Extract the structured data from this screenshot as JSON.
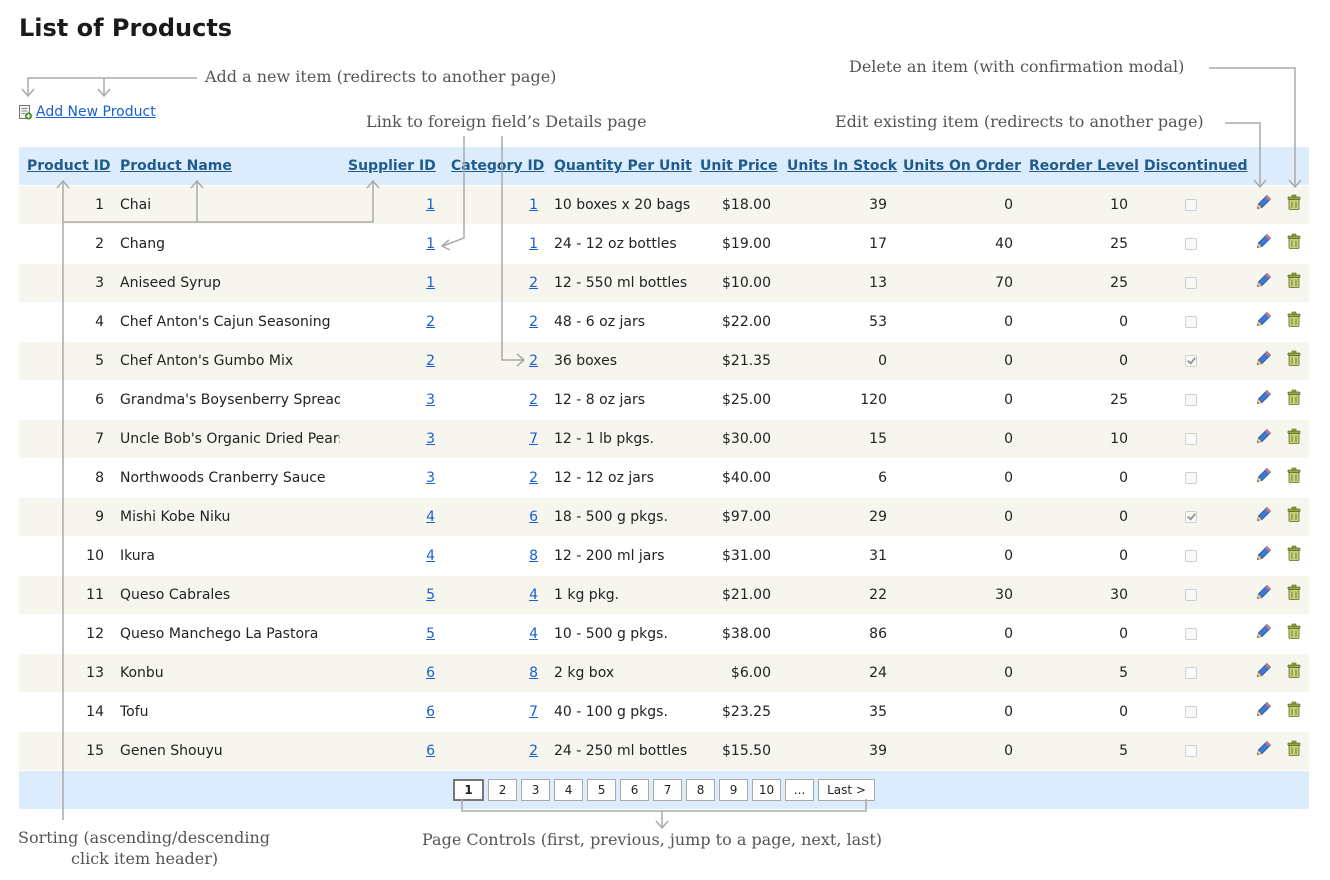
{
  "page": {
    "title": "List of Products"
  },
  "toolbar": {
    "add_label": "Add New Product",
    "add_icon": "add-item-icon"
  },
  "columns": [
    "Product ID",
    "Product Name",
    "Supplier ID",
    "Category ID",
    "Quantity Per Unit",
    "Unit Price",
    "Units In Stock",
    "Units On Order",
    "Reorder Level",
    "Discontinued"
  ],
  "rows": [
    {
      "id": "1",
      "name": "Chai",
      "supplier": "1",
      "category": "1",
      "qty": "10 boxes x 20 bags",
      "price": "$18.00",
      "stock": "39",
      "order": "0",
      "reorder": "10",
      "discontinued": false
    },
    {
      "id": "2",
      "name": "Chang",
      "supplier": "1",
      "category": "1",
      "qty": "24 - 12 oz bottles",
      "price": "$19.00",
      "stock": "17",
      "order": "40",
      "reorder": "25",
      "discontinued": false
    },
    {
      "id": "3",
      "name": "Aniseed Syrup",
      "supplier": "1",
      "category": "2",
      "qty": "12 - 550 ml bottles",
      "price": "$10.00",
      "stock": "13",
      "order": "70",
      "reorder": "25",
      "discontinued": false
    },
    {
      "id": "4",
      "name": "Chef Anton's Cajun Seasoning",
      "supplier": "2",
      "category": "2",
      "qty": "48 - 6 oz jars",
      "price": "$22.00",
      "stock": "53",
      "order": "0",
      "reorder": "0",
      "discontinued": false
    },
    {
      "id": "5",
      "name": "Chef Anton's Gumbo Mix",
      "supplier": "2",
      "category": "2",
      "qty": "36 boxes",
      "price": "$21.35",
      "stock": "0",
      "order": "0",
      "reorder": "0",
      "discontinued": true
    },
    {
      "id": "6",
      "name": "Grandma's Boysenberry Spread",
      "supplier": "3",
      "category": "2",
      "qty": "12 - 8 oz jars",
      "price": "$25.00",
      "stock": "120",
      "order": "0",
      "reorder": "25",
      "discontinued": false
    },
    {
      "id": "7",
      "name": "Uncle Bob's Organic Dried Pears",
      "supplier": "3",
      "category": "7",
      "qty": "12 - 1 lb pkgs.",
      "price": "$30.00",
      "stock": "15",
      "order": "0",
      "reorder": "10",
      "discontinued": false
    },
    {
      "id": "8",
      "name": "Northwoods Cranberry Sauce",
      "supplier": "3",
      "category": "2",
      "qty": "12 - 12 oz jars",
      "price": "$40.00",
      "stock": "6",
      "order": "0",
      "reorder": "0",
      "discontinued": false
    },
    {
      "id": "9",
      "name": "Mishi Kobe Niku",
      "supplier": "4",
      "category": "6",
      "qty": "18 - 500 g pkgs.",
      "price": "$97.00",
      "stock": "29",
      "order": "0",
      "reorder": "0",
      "discontinued": true
    },
    {
      "id": "10",
      "name": "Ikura",
      "supplier": "4",
      "category": "8",
      "qty": "12 - 200 ml jars",
      "price": "$31.00",
      "stock": "31",
      "order": "0",
      "reorder": "0",
      "discontinued": false
    },
    {
      "id": "11",
      "name": "Queso Cabrales",
      "supplier": "5",
      "category": "4",
      "qty": "1 kg pkg.",
      "price": "$21.00",
      "stock": "22",
      "order": "30",
      "reorder": "30",
      "discontinued": false
    },
    {
      "id": "12",
      "name": "Queso Manchego La Pastora",
      "supplier": "5",
      "category": "4",
      "qty": "10 - 500 g pkgs.",
      "price": "$38.00",
      "stock": "86",
      "order": "0",
      "reorder": "0",
      "discontinued": false
    },
    {
      "id": "13",
      "name": "Konbu",
      "supplier": "6",
      "category": "8",
      "qty": "2 kg box",
      "price": "$6.00",
      "stock": "24",
      "order": "0",
      "reorder": "5",
      "discontinued": false
    },
    {
      "id": "14",
      "name": "Tofu",
      "supplier": "6",
      "category": "7",
      "qty": "40 - 100 g pkgs.",
      "price": "$23.25",
      "stock": "35",
      "order": "0",
      "reorder": "0",
      "discontinued": false
    },
    {
      "id": "15",
      "name": "Genen Shouyu",
      "supplier": "6",
      "category": "2",
      "qty": "24 - 250 ml bottles",
      "price": "$15.50",
      "stock": "39",
      "order": "0",
      "reorder": "5",
      "discontinued": false
    }
  ],
  "row_actions": {
    "edit_icon": "pencil-icon",
    "delete_icon": "trash-can-icon"
  },
  "pager": {
    "pages": [
      "1",
      "2",
      "3",
      "4",
      "5",
      "6",
      "7",
      "8",
      "9",
      "10",
      "..."
    ],
    "current": "1",
    "last_label": "Last >"
  },
  "annotations": {
    "add": "Add a new item (redirects to another page)",
    "delete": "Delete an item (with confirmation modal)",
    "link": "Link to foreign field’s Details page",
    "edit": "Edit existing item (redirects to another page)",
    "sorting_line1": "Sorting (ascending/descending",
    "sorting_line2": "click item header)",
    "pager": "Page Controls (first, previous, jump to a page, next, last)"
  },
  "colors": {
    "header_bg": "#dcecfc",
    "row_alt_bg": "#f6f5ee",
    "link": "#1a5fd0",
    "header_link": "#205b8e",
    "annotation_line": "#aaaaaa"
  }
}
